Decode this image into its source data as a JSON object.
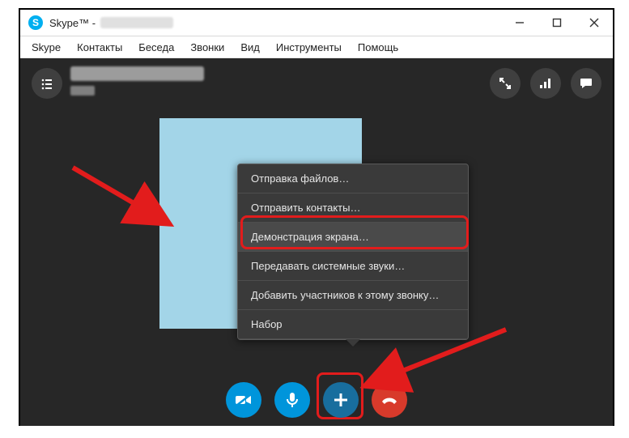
{
  "window": {
    "title_prefix": "Skype™ - "
  },
  "menubar": {
    "items": [
      "Skype",
      "Контакты",
      "Беседа",
      "Звонки",
      "Вид",
      "Инструменты",
      "Помощь"
    ]
  },
  "popup": {
    "items": [
      {
        "label": "Отправка файлов…"
      },
      {
        "label": "Отправить контакты…"
      },
      {
        "label": "Демонстрация экрана…",
        "hover": true
      },
      {
        "label": "Передавать системные звуки…"
      },
      {
        "label": "Добавить участников к этому звонку…"
      },
      {
        "label": "Набор"
      }
    ]
  },
  "icons": {
    "camera_off": "camera-off-icon",
    "mic": "mic-icon",
    "plus": "plus-icon",
    "hangup": "hangup-icon",
    "participants": "participants-icon",
    "fullscreen": "fullscreen-icon",
    "quality": "quality-icon",
    "chat": "chat-icon"
  }
}
